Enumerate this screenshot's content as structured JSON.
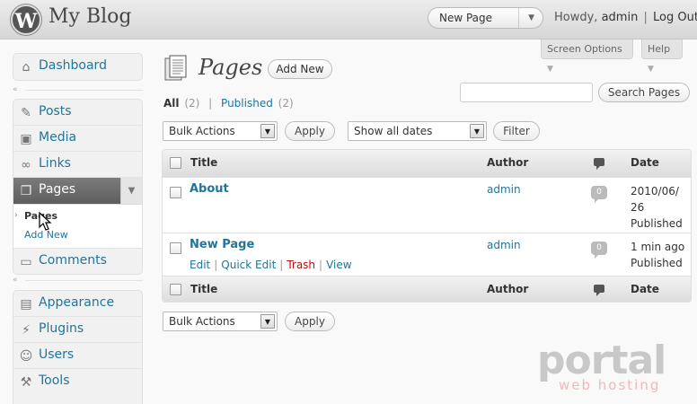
{
  "header": {
    "site_title": "My Blog",
    "favorite_actions": "New Page",
    "howdy": "Howdy,",
    "username": "admin",
    "separator": "|",
    "logout": "Log Out"
  },
  "screen_meta": {
    "screen_options": "Screen Options",
    "help": "Help"
  },
  "sidebar": {
    "dashboard": {
      "label": "Dashboard",
      "icon": "dashboard-icon"
    },
    "posts": {
      "label": "Posts",
      "icon": "pushpin-icon"
    },
    "media": {
      "label": "Media",
      "icon": "media-icon"
    },
    "links": {
      "label": "Links",
      "icon": "link-icon"
    },
    "pages": {
      "label": "Pages",
      "icon": "pages-icon"
    },
    "pages_sub": [
      {
        "label": "Pages"
      },
      {
        "label": "Add New"
      }
    ],
    "comments": {
      "label": "Comments",
      "icon": "comment-icon"
    },
    "appearance": {
      "label": "Appearance",
      "icon": "appearance-icon"
    },
    "plugins": {
      "label": "Plugins",
      "icon": "plugin-icon"
    },
    "users": {
      "label": "Users",
      "icon": "users-icon"
    },
    "tools": {
      "label": "Tools",
      "icon": "tools-icon"
    }
  },
  "main": {
    "title": "Pages",
    "add_new": "Add New",
    "status": {
      "all_label": "All",
      "all_count": "(2)",
      "pipe": "|",
      "published_label": "Published",
      "published_count": "(2)"
    },
    "search_value": "",
    "search_button": "Search Pages",
    "bulk_actions": "Bulk Actions",
    "apply": "Apply",
    "date_filter": "Show all dates",
    "filter": "Filter"
  },
  "table": {
    "columns": {
      "title": "Title",
      "author": "Author",
      "date": "Date"
    },
    "rows": [
      {
        "title": "About",
        "author": "admin",
        "comments": "0",
        "date_line1": "2010/06/",
        "date_line2": "26",
        "date_line3": "Published"
      },
      {
        "title": "New Page",
        "author": "admin",
        "comments": "0",
        "date_line1": "1 min ago",
        "date_line2": "Published",
        "actions": {
          "edit": "Edit",
          "quick_edit": "Quick Edit",
          "trash": "Trash",
          "view": "View",
          "pipe": "|"
        }
      }
    ]
  },
  "watermark": {
    "main": "portal",
    "sub": "web hosting"
  },
  "colors": {
    "link": "#21759b",
    "trash": "#bc0b0b",
    "current_menu": "#6d6d6d"
  }
}
